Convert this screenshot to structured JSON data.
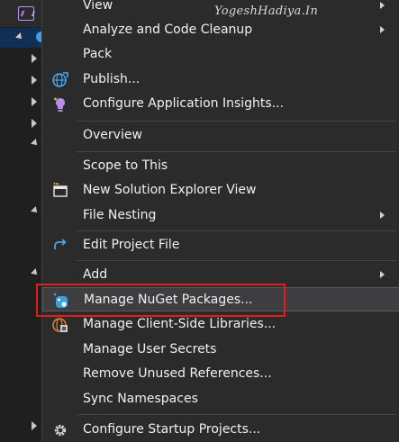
{
  "watermark": "YogeshHadiya.In",
  "menu": {
    "items": [
      {
        "label": "View",
        "icon": "",
        "submenu": true
      },
      {
        "label": "Analyze and Code Cleanup",
        "icon": "",
        "submenu": true
      },
      {
        "label": "Pack",
        "icon": "",
        "submenu": false
      },
      {
        "label": "Publish...",
        "icon": "globe-publish-icon",
        "submenu": false
      },
      {
        "label": "Configure Application Insights...",
        "icon": "insights-bulb-icon",
        "submenu": false
      },
      {
        "label": "Overview",
        "icon": "",
        "submenu": false
      },
      {
        "label": "Scope to This",
        "icon": "",
        "submenu": false
      },
      {
        "label": "New Solution Explorer View",
        "icon": "new-window-icon",
        "submenu": false
      },
      {
        "label": "File Nesting",
        "icon": "",
        "submenu": true
      },
      {
        "label": "Edit Project File",
        "icon": "edit-arrow-icon",
        "submenu": false
      },
      {
        "label": "Add",
        "icon": "",
        "submenu": true
      },
      {
        "label": "Manage NuGet Packages...",
        "icon": "nuget-icon",
        "submenu": false,
        "highlighted": true
      },
      {
        "label": "Manage Client-Side Libraries...",
        "icon": "client-libraries-icon",
        "submenu": false
      },
      {
        "label": "Manage User Secrets",
        "icon": "",
        "submenu": false
      },
      {
        "label": "Remove Unused References...",
        "icon": "",
        "submenu": false
      },
      {
        "label": "Sync Namespaces",
        "icon": "",
        "submenu": false
      },
      {
        "label": "Configure Startup Projects...",
        "icon": "gear-icon",
        "submenu": false
      }
    ]
  },
  "colors": {
    "menu_bg": "#2b2b2b",
    "text": "#f1f1f1",
    "highlight_bg": "#3e3e40",
    "callout_border": "#e01e1e",
    "nuget_blue": "#3c9fe0"
  }
}
